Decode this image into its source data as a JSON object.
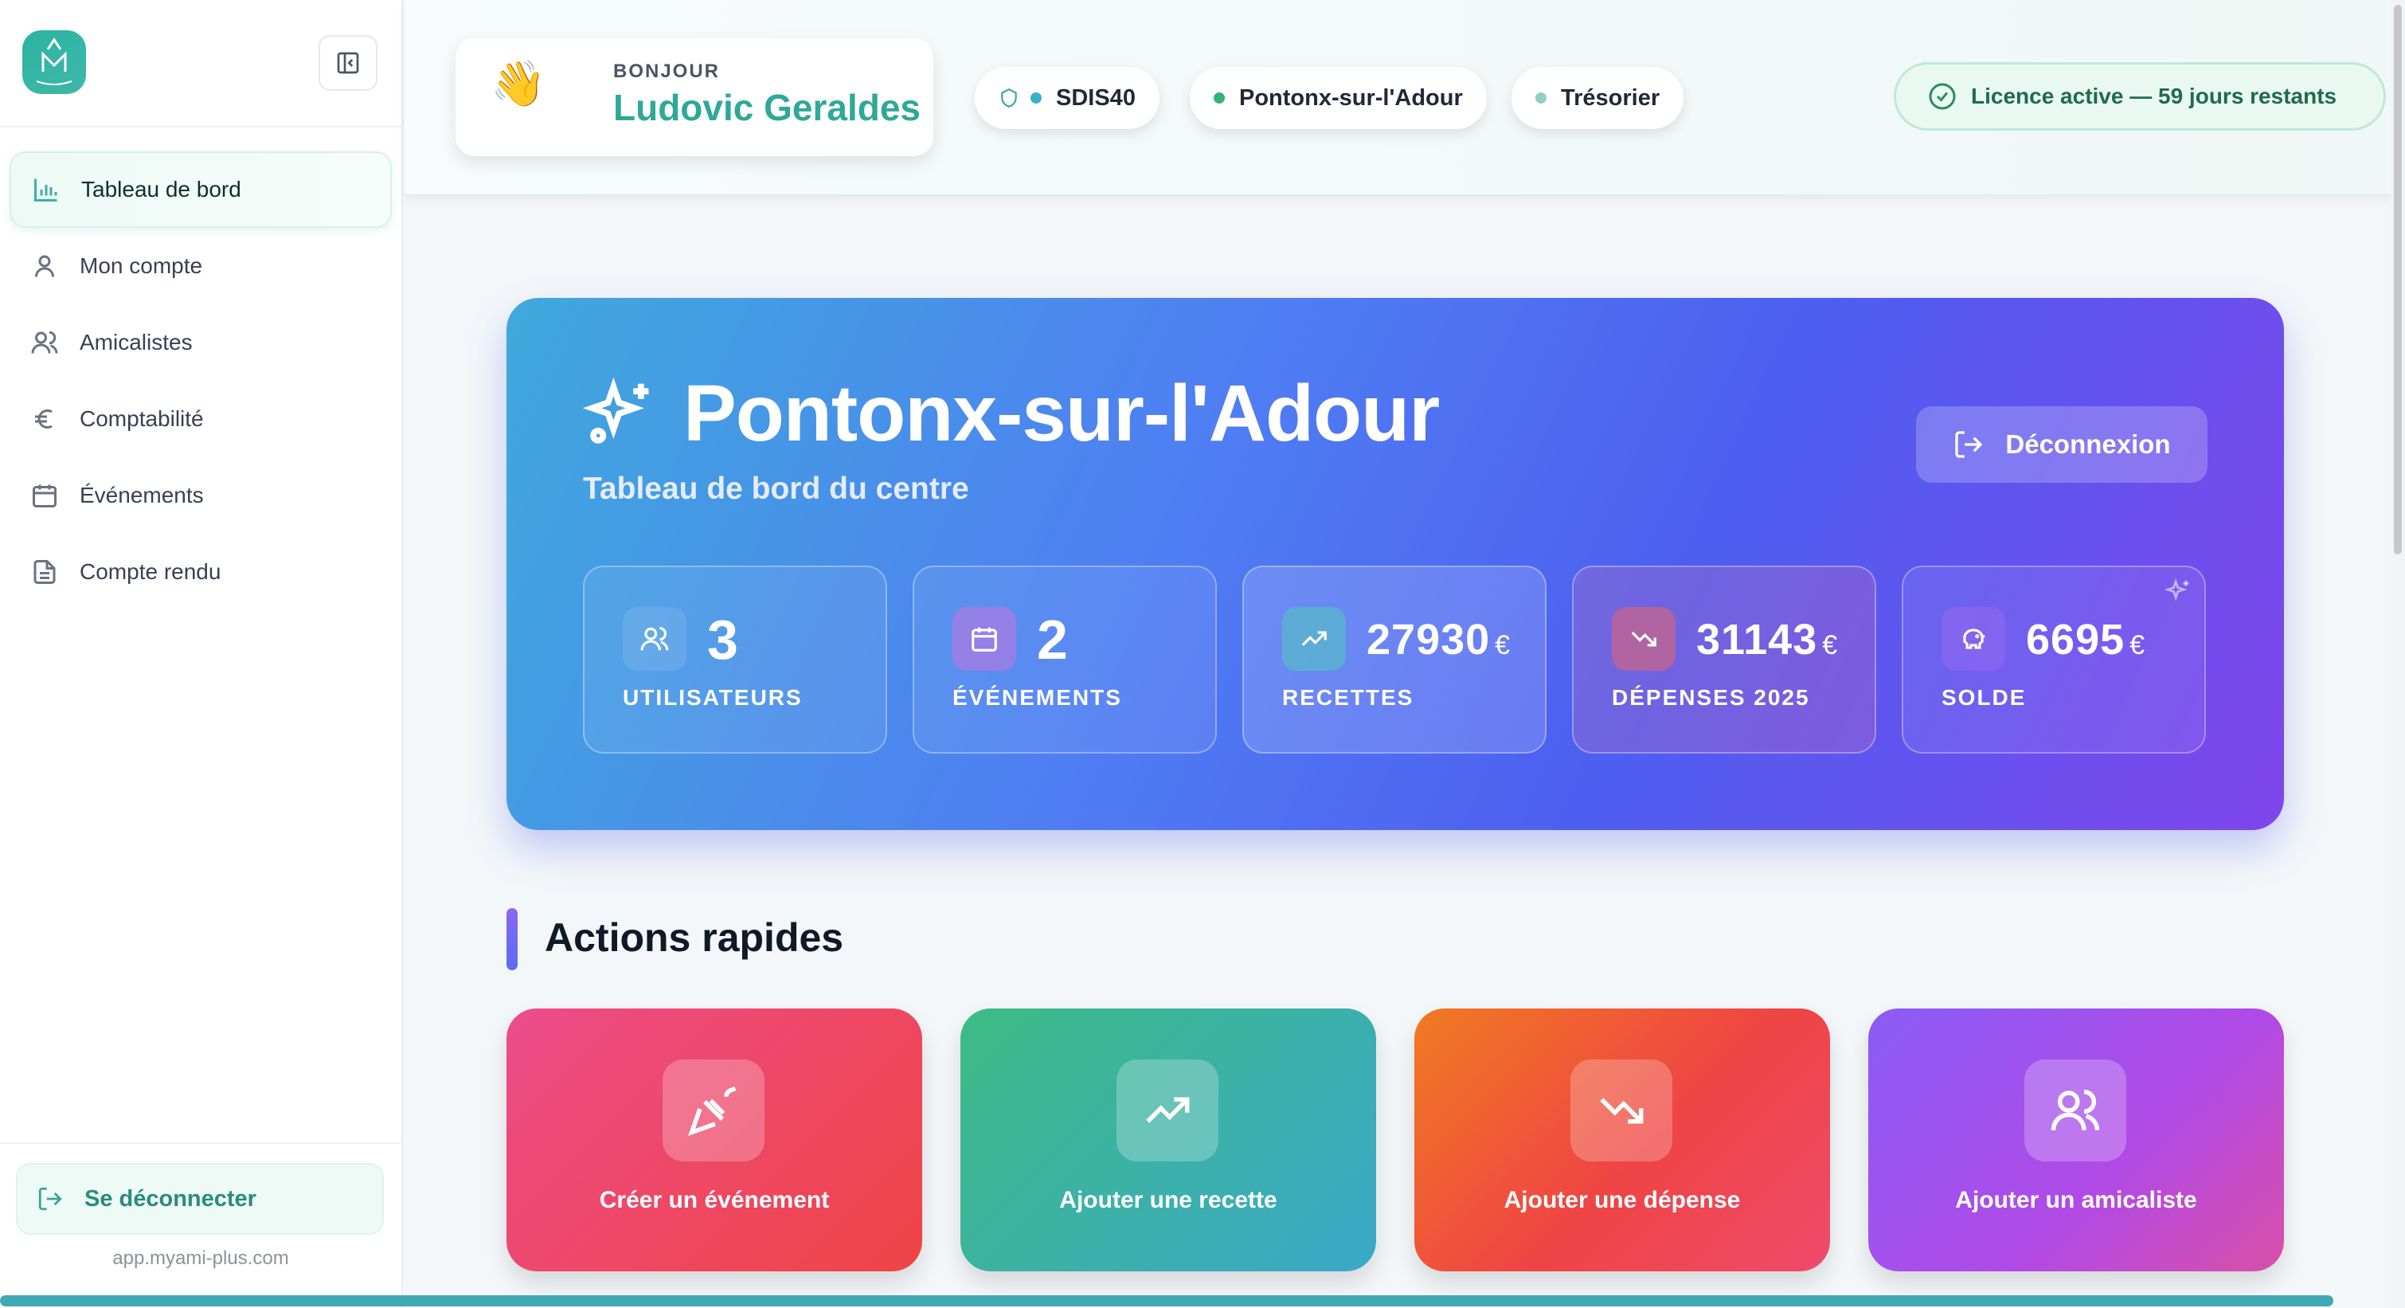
{
  "sidebar": {
    "logo_letters": "M",
    "logo_sub": "AMI",
    "items": [
      {
        "label": "Tableau de bord",
        "icon": "bar-chart-icon",
        "active": true
      },
      {
        "label": "Mon compte",
        "icon": "user-icon"
      },
      {
        "label": "Amicalistes",
        "icon": "users-icon"
      },
      {
        "label": "Comptabilité",
        "icon": "euro-icon"
      },
      {
        "label": "Événements",
        "icon": "calendar-icon"
      },
      {
        "label": "Compte rendu",
        "icon": "file-text-icon"
      }
    ],
    "logout_label": "Se déconnecter",
    "site": "app.myami-plus.com"
  },
  "header": {
    "greeting_emoji": "👋",
    "greeting_small": "BONJOUR",
    "user_name": "Ludovic Geraldes",
    "chips": [
      {
        "label": "SDIS40",
        "dot_color": "#38b2c8"
      },
      {
        "label": "Pontonx-sur-l'Adour",
        "dot_color": "#34b27a"
      },
      {
        "label": "Trésorier",
        "dot_color": "#8fd0c6"
      }
    ],
    "licence": "Licence active — 59 jours restants"
  },
  "hero": {
    "title": "Pontonx-sur-l'Adour",
    "subtitle": "Tableau de bord du centre",
    "logout_button": "Déconnexion",
    "stats": [
      {
        "value": "3",
        "currency": "",
        "label": "UTILISATEURS",
        "icon": "users-icon"
      },
      {
        "value": "2",
        "currency": "",
        "label": "ÉVÉNEMENTS",
        "icon": "calendar-icon"
      },
      {
        "value": "27930",
        "currency": "€",
        "label": "RECETTES",
        "icon": "trending-up-icon"
      },
      {
        "value": "31143",
        "currency": "€",
        "label": "DÉPENSES 2025",
        "icon": "trending-down-icon"
      },
      {
        "value": "6695",
        "currency": "€",
        "label": "SOLDE",
        "icon": "piggy-bank-icon"
      }
    ]
  },
  "actions": {
    "title": "Actions rapides",
    "cards": [
      {
        "label": "Créer un événement",
        "icon": "party-popper-icon"
      },
      {
        "label": "Ajouter une recette",
        "icon": "trending-up-icon"
      },
      {
        "label": "Ajouter une dépense",
        "icon": "trending-down-icon"
      },
      {
        "label": "Ajouter un amicaliste",
        "icon": "users-icon"
      }
    ]
  },
  "colors": {
    "accent": "#3bb3a2",
    "hero_start": "#3fa9dc",
    "hero_end": "#7f45ec"
  }
}
